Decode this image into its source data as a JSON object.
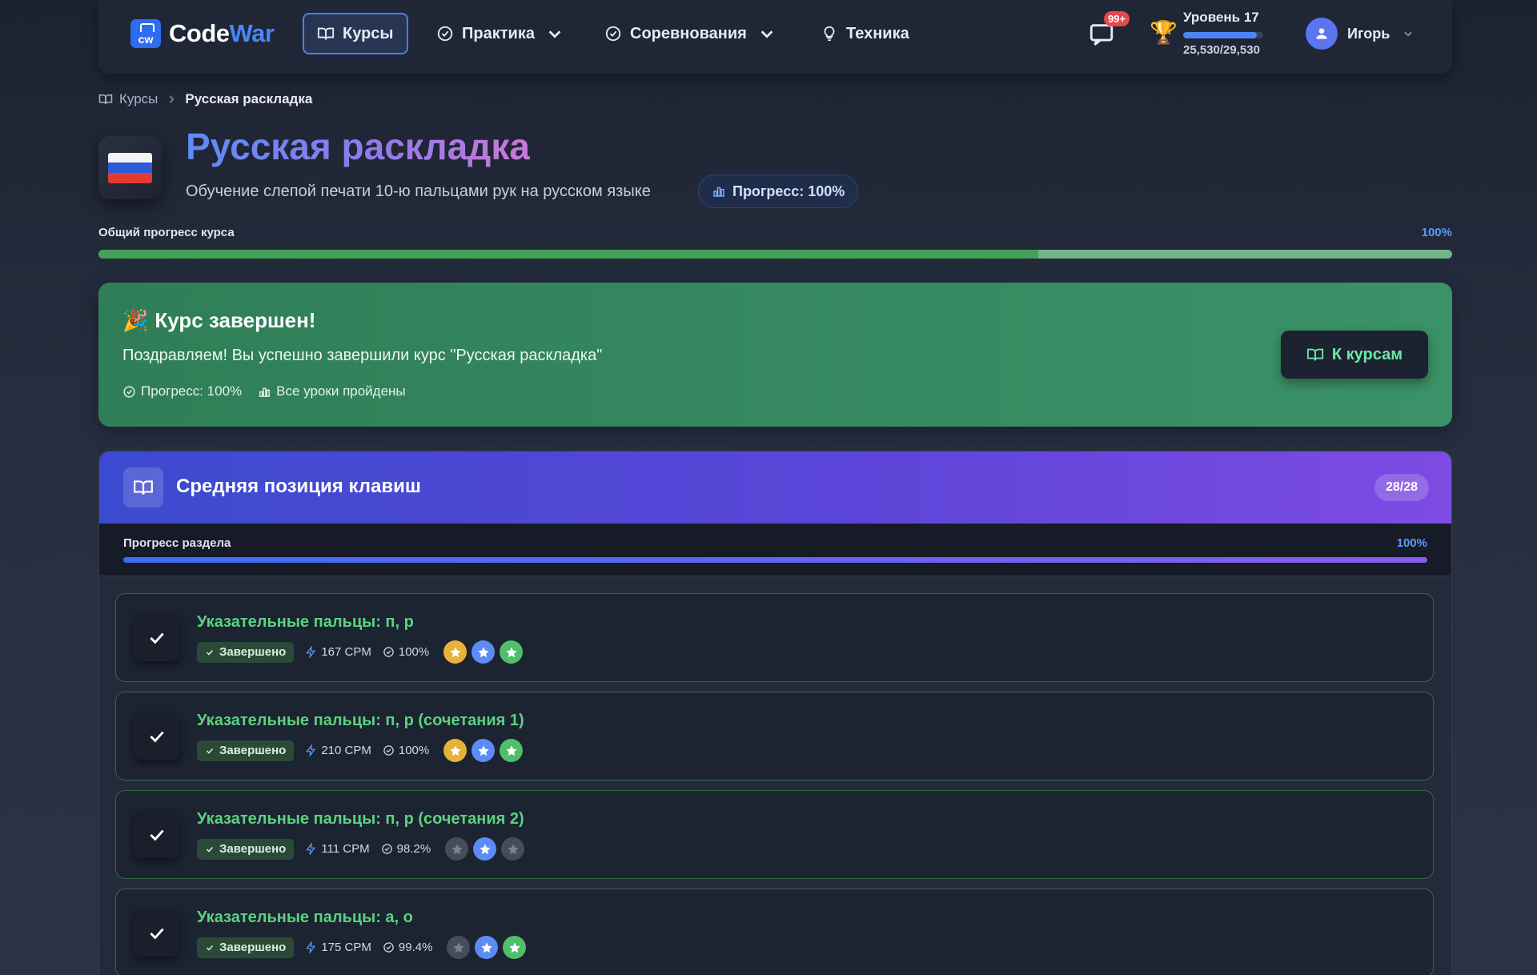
{
  "app": {
    "logo_short": "cw",
    "logo_part1": "Code",
    "logo_part2": "War"
  },
  "nav": {
    "courses": "Курсы",
    "practice": "Практика",
    "competitions": "Соревнования",
    "technique": "Техника"
  },
  "header": {
    "notif_count": "99+",
    "level_title": "Уровень 17",
    "level_progress": 0.92,
    "xp": "25,530/29,530",
    "user_name": "Игорь"
  },
  "breadcrumb": {
    "root": "Курсы",
    "current": "Русская раскладка"
  },
  "course": {
    "title": "Русская раскладка",
    "subtitle": "Обучение слепой печати 10-ю пальцами рук на русском языке",
    "progress_pill": "Прогресс: 100%",
    "overall_label": "Общий прогресс курса",
    "overall_pct": "100%",
    "overall_value": 1.0
  },
  "completion": {
    "title": "Курс завершен!",
    "text": "Поздравляем! Вы успешно завершили курс \"Русская раскладка\"",
    "meta_progress": "Прогресс: 100%",
    "meta_lessons": "Все уроки пройдены",
    "button": "К курсам"
  },
  "section": {
    "title": "Средняя позиция клавиш",
    "count": "28/28",
    "progress_label": "Прогресс раздела",
    "progress_pct": "100%",
    "progress_value": 1.0
  },
  "lessons": [
    {
      "title": "Указательные пальцы: п, р",
      "status": "Завершено",
      "cpm": "167 CPM",
      "accuracy": "100%",
      "stars": [
        "gold",
        "blue",
        "green"
      ]
    },
    {
      "title": "Указательные пальцы: п, р (сочетания 1)",
      "status": "Завершено",
      "cpm": "210 CPM",
      "accuracy": "100%",
      "stars": [
        "gold",
        "blue",
        "green"
      ]
    },
    {
      "title": "Указательные пальцы: п, р (сочетания 2)",
      "status": "Завершено",
      "cpm": "111 CPM",
      "accuracy": "98.2%",
      "stars": [
        "gray",
        "blue",
        "gray"
      ]
    },
    {
      "title": "Указательные пальцы: а, о",
      "status": "Завершено",
      "cpm": "175 CPM",
      "accuracy": "99.4%",
      "stars": [
        "gray",
        "blue",
        "green"
      ]
    }
  ],
  "colors": {
    "accent": "#4a86f7",
    "success": "#43a15c",
    "star_gold": "#e5b23a",
    "star_blue": "#5b8cf6",
    "star_green": "#4fbf6a",
    "star_gray": "#454c5c"
  }
}
